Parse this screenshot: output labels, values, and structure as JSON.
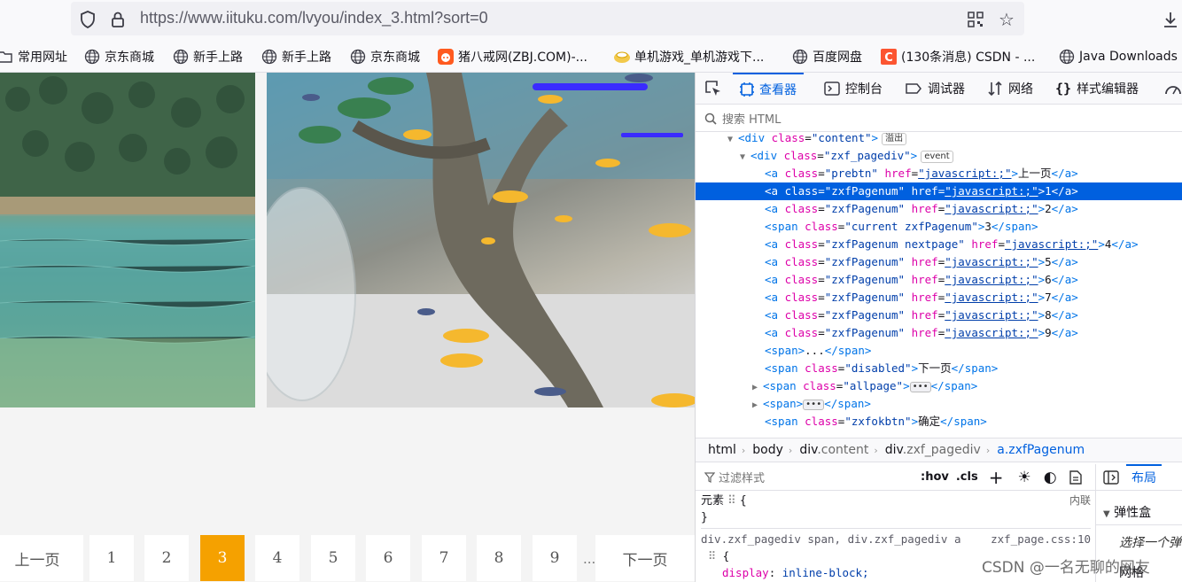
{
  "browser": {
    "url": "https://www.iituku.com/lvyou/index_3.html?sort=0",
    "bookmarks": [
      {
        "label": "常用网址",
        "icon": "folder-icon"
      },
      {
        "label": "京东商城",
        "icon": "globe-icon"
      },
      {
        "label": "新手上路",
        "icon": "globe-icon"
      },
      {
        "label": "新手上路",
        "icon": "globe-icon"
      },
      {
        "label": "京东商城",
        "icon": "globe-icon"
      },
      {
        "label": "猪八戒网(ZBJ.COM)-...",
        "icon": "zbj-icon"
      },
      {
        "label": "单机游戏_单机游戏下...",
        "icon": "game-icon"
      },
      {
        "label": "百度网盘",
        "icon": "globe-icon"
      },
      {
        "label": "(130条消息) CSDN - ...",
        "icon": "csdn-icon"
      },
      {
        "label": "Java Downloads",
        "icon": "globe-icon"
      }
    ]
  },
  "pagination": {
    "prev": "上一页",
    "pages": [
      "1",
      "2",
      "3",
      "4",
      "5",
      "6",
      "7",
      "8",
      "9"
    ],
    "current": "3",
    "ellipsis": "...",
    "next": "下一页",
    "accent": "#f5a100"
  },
  "devtools": {
    "tabs": [
      {
        "label": "查看器",
        "icon": "inspector-icon",
        "active": true
      },
      {
        "label": "控制台",
        "icon": "console-icon"
      },
      {
        "label": "调试器",
        "icon": "debugger-icon"
      },
      {
        "label": "网络",
        "icon": "network-icon"
      },
      {
        "label": "样式编辑器",
        "icon": "style-editor-icon"
      }
    ],
    "search_placeholder": "搜索 HTML",
    "dom": {
      "content_div": {
        "tag": "div",
        "attr": "class",
        "value": "\"content\"",
        "badge": "溢出"
      },
      "pagediv": {
        "tag": "div",
        "attr": "class",
        "value": "\"zxf_pagediv\"",
        "badge": "event"
      },
      "links": [
        {
          "cls": "\"prebtn\"",
          "text": "上一页",
          "selected": false
        },
        {
          "cls": "\"zxfPagenum\"",
          "text": "1",
          "selected": true
        },
        {
          "cls": "\"zxfPagenum\"",
          "text": "2",
          "selected": false
        }
      ],
      "current_span": {
        "cls": "\"current zxfPagenum\"",
        "text": "3"
      },
      "next_link": {
        "cls": "\"zxfPagenum nextpage\"",
        "text": "4"
      },
      "more_links": [
        {
          "cls": "\"zxfPagenum\"",
          "text": "5"
        },
        {
          "cls": "\"zxfPagenum\"",
          "text": "6"
        },
        {
          "cls": "\"zxfPagenum\"",
          "text": "7"
        },
        {
          "cls": "\"zxfPagenum\"",
          "text": "8"
        },
        {
          "cls": "\"zxfPagenum\"",
          "text": "9"
        }
      ],
      "href": "\"javascript:;\"",
      "dots_span": "...",
      "disabled_span": {
        "cls": "\"disabled\"",
        "text": "下一页"
      },
      "allpage_span": {
        "cls": "\"allpage\""
      },
      "okbtn_span": {
        "cls": "\"zxfokbtn\"",
        "text": "确定"
      }
    },
    "breadcrumb": [
      {
        "tag": "html",
        "cls": ""
      },
      {
        "tag": "body",
        "cls": ""
      },
      {
        "tag": "div",
        "cls": ".content"
      },
      {
        "tag": "div",
        "cls": ".zxf_pagediv"
      },
      {
        "tag": "a",
        "cls": ".zxfPagenum"
      }
    ],
    "rules": {
      "filter_placeholder": "过滤样式",
      "hov": ":hov",
      "cls": ".cls",
      "element_label": "元素",
      "inline_label": "内联",
      "selector": "div.zxf_pagediv span, div.zxf_pagediv a",
      "source": "zxf_page.css:10",
      "property": "display",
      "prop_value": "inline-block;"
    },
    "layout": {
      "tab": "布局",
      "flexbox": "弹性盒",
      "choose": "选择一个弹",
      "grid": "网格"
    }
  },
  "watermark": "CSDN @一名无聊的网友"
}
